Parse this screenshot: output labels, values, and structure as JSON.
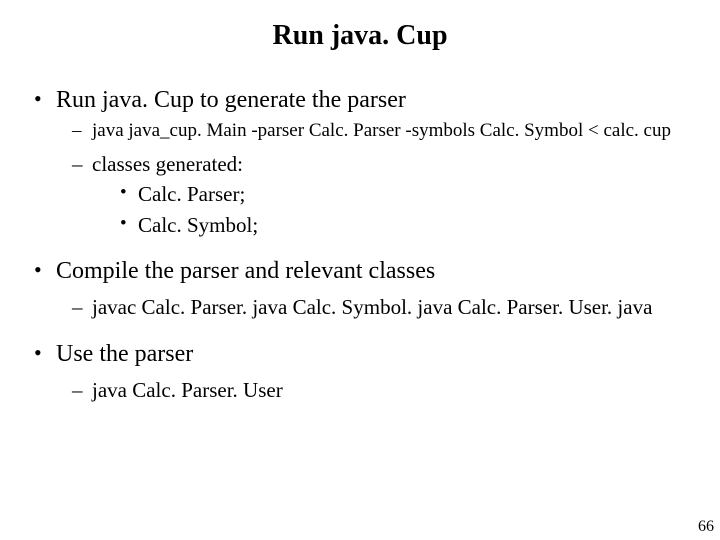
{
  "title": "Run java. Cup",
  "bullets": {
    "b1": "Run java. Cup to generate the parser",
    "b1_s1": "java java_cup. Main -parser Calc. Parser -symbols Calc. Symbol < calc. cup",
    "b1_s2": "classes generated:",
    "b1_s2_a": "Calc. Parser;",
    "b1_s2_b": "Calc. Symbol;",
    "b2": "Compile the parser and relevant classes",
    "b2_s1": "javac Calc. Parser. java Calc. Symbol. java Calc. Parser. User. java",
    "b3": "Use the parser",
    "b3_s1": "java Calc. Parser. User"
  },
  "glyphs": {
    "disc": "•",
    "dash": "–"
  },
  "page_number": "66"
}
